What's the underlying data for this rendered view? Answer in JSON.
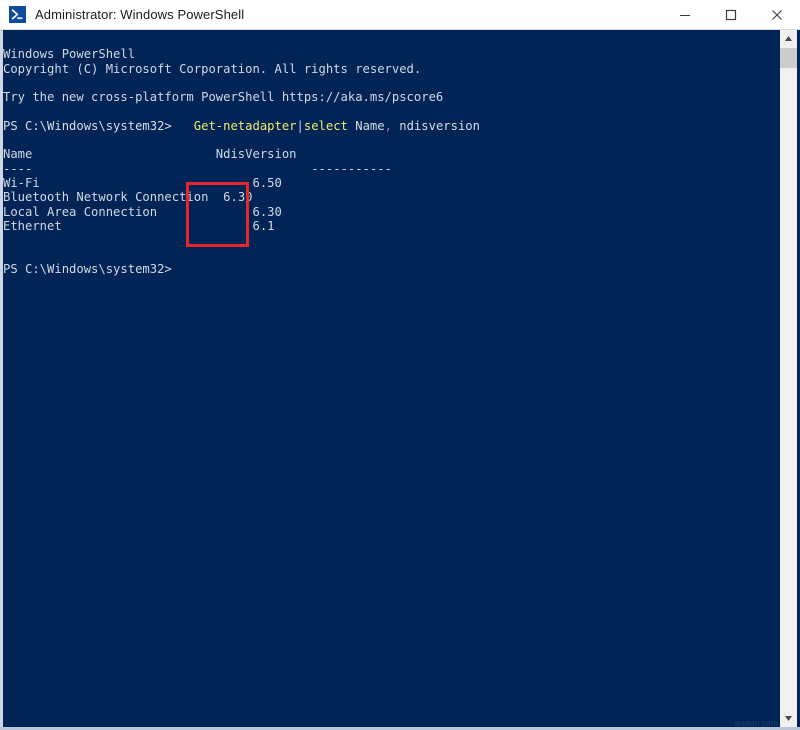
{
  "window": {
    "title": "Administrator: Windows PowerShell",
    "icon": "powershell-icon",
    "background_color": "#012456",
    "titlebar_color": "#ffffff",
    "controls": {
      "minimize": "minimize",
      "maximize": "maximize",
      "close": "close"
    }
  },
  "console": {
    "banner": {
      "line1": "Windows PowerShell",
      "line2": "Copyright (C) Microsoft Corporation. All rights reserved.",
      "line3": "Try the new cross-platform PowerShell https://aka.ms/pscore6"
    },
    "prompt": {
      "path": "PS C:\\Windows\\system32>",
      "command_cmdlet": "Get-netadapter",
      "command_pipe": "|",
      "command_select": "select",
      "command_arg1": " Name",
      "command_comma": ",",
      "command_arg2": " ndisversion"
    },
    "table": {
      "headers": [
        "Name",
        "NdisVersion"
      ],
      "header_underlines": [
        "----",
        "-----------"
      ],
      "rows": [
        {
          "name": "Wi-Fi",
          "ndis_version": "6.50"
        },
        {
          "name": "Bluetooth Network Connection",
          "ndis_version": "6.30"
        },
        {
          "name": "Local Area Connection",
          "ndis_version": "6.30"
        },
        {
          "name": "Ethernet",
          "ndis_version": "6.1"
        }
      ]
    },
    "final_prompt": "PS C:\\Windows\\system32>",
    "colors": {
      "text": "#cfd8e3",
      "cmdlet": "#eeed6b",
      "parameter_separator": "#b96ab4",
      "background": "#012456"
    }
  },
  "annotation": {
    "highlight_label": "NdisVersion values highlighted",
    "highlight_color": "#e8262a"
  },
  "scrollbar": {
    "up_arrow": "scroll-up",
    "down_arrow": "scroll-down",
    "thumb": "scroll-thumb"
  },
  "watermark": "wsdon.com"
}
